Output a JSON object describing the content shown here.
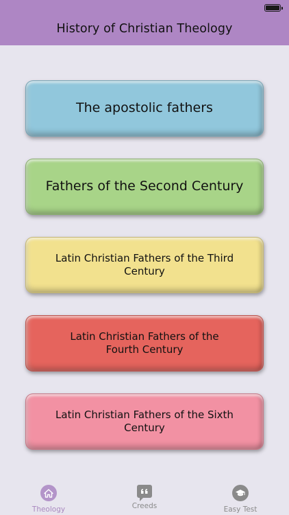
{
  "header": {
    "title": "History of Christian Theology",
    "background": "#ae86c4"
  },
  "cards": [
    {
      "label": "The apostolic fathers",
      "color": "#91c7dc"
    },
    {
      "label": "Fathers of the Second Century",
      "color": "#a8d488"
    },
    {
      "label": "Latin Christian Fathers of the Third Century",
      "color": "#f2e18e"
    },
    {
      "label": "Latin Christian Fathers of the Fourth Century",
      "color": "#e5645d"
    },
    {
      "label": "Latin Christian Fathers of the Sixth Century",
      "color": "#f291a3"
    }
  ],
  "tabbar": {
    "tabs": [
      {
        "label": "Theology",
        "icon": "home-icon",
        "active": true
      },
      {
        "label": "Creeds",
        "icon": "quote-icon",
        "active": false
      },
      {
        "label": "Easy Test",
        "icon": "graduation-cap-icon",
        "active": false
      }
    ],
    "active_color": "#a988bf",
    "inactive_color": "#8a8a8a"
  }
}
